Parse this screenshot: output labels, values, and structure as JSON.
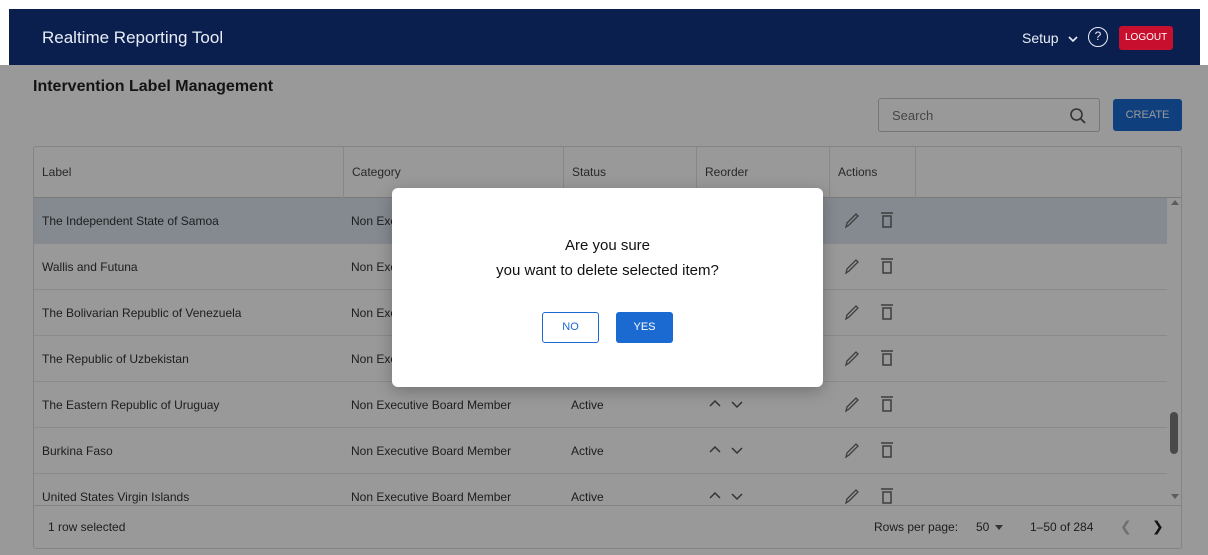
{
  "header": {
    "app_title": "Realtime Reporting Tool",
    "setup_label": "Setup",
    "help_symbol": "?",
    "logout_label": "LOGOUT"
  },
  "page": {
    "title": "Intervention Label Management"
  },
  "search": {
    "placeholder": "Search"
  },
  "create_label": "CREATE",
  "table": {
    "columns": {
      "label": "Label",
      "category": "Category",
      "status": "Status",
      "reorder": "Reorder",
      "actions": "Actions"
    },
    "rows": [
      {
        "label": "The Independent State of Samoa",
        "category": "Non Exe",
        "status": "",
        "selected": true
      },
      {
        "label": "Wallis and Futuna",
        "category": "Non Exe",
        "status": ""
      },
      {
        "label": "The Bolivarian Republic of Venezuela",
        "category": "Non Exe",
        "status": ""
      },
      {
        "label": "The Republic of Uzbekistan",
        "category": "Non Exe",
        "status": ""
      },
      {
        "label": "The Eastern Republic of Uruguay",
        "category": "Non Executive Board Member",
        "status": "Active"
      },
      {
        "label": "Burkina Faso",
        "category": "Non Executive Board Member",
        "status": "Active"
      },
      {
        "label": "United States Virgin Islands",
        "category": "Non Executive Board Member",
        "status": "Active"
      }
    ]
  },
  "footer": {
    "selection_text": "1 row selected",
    "rows_per_page_label": "Rows per page:",
    "rows_per_page_value": "50",
    "range_text": "1–50 of 284"
  },
  "dialog": {
    "line1": "Are you sure",
    "line2": "you want to delete selected item?",
    "no_label": "NO",
    "yes_label": "YES"
  },
  "colors": {
    "header_bg": "#0b1f4f",
    "logout_bg": "#c8102e",
    "primary": "#1b6ad1",
    "selected_row": "#dde6f1"
  }
}
